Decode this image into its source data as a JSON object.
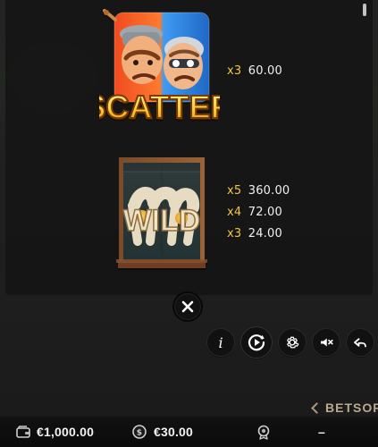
{
  "paytable": {
    "scatter": {
      "label": "SCATTER",
      "rows": [
        {
          "mult": "x3",
          "amount": "60.00"
        }
      ]
    },
    "wild": {
      "label": "WILD",
      "rows": [
        {
          "mult": "x5",
          "amount": "360.00"
        },
        {
          "mult": "x4",
          "amount": "72.00"
        },
        {
          "mult": "x3",
          "amount": "24.00"
        }
      ]
    }
  },
  "controls": {
    "buttons": [
      {
        "name": "info",
        "icon": "info-icon"
      },
      {
        "name": "autoplay",
        "icon": "autoplay-icon"
      },
      {
        "name": "settings",
        "icon": "gear-icon"
      },
      {
        "name": "sound",
        "icon": "speaker-muted-icon"
      },
      {
        "name": "back",
        "icon": "back-arrow-icon"
      }
    ],
    "close_icon": "close-icon"
  },
  "branding": {
    "logo_text": "BETSOFT"
  },
  "bottom_bar": {
    "balance": "€1,000.00",
    "bet": "€30.00",
    "win": "–"
  },
  "colors": {
    "multiplier": "#f2c443",
    "amount": "#f0f0f0",
    "background": "#1f1f1f",
    "button_bg": "#111111"
  }
}
